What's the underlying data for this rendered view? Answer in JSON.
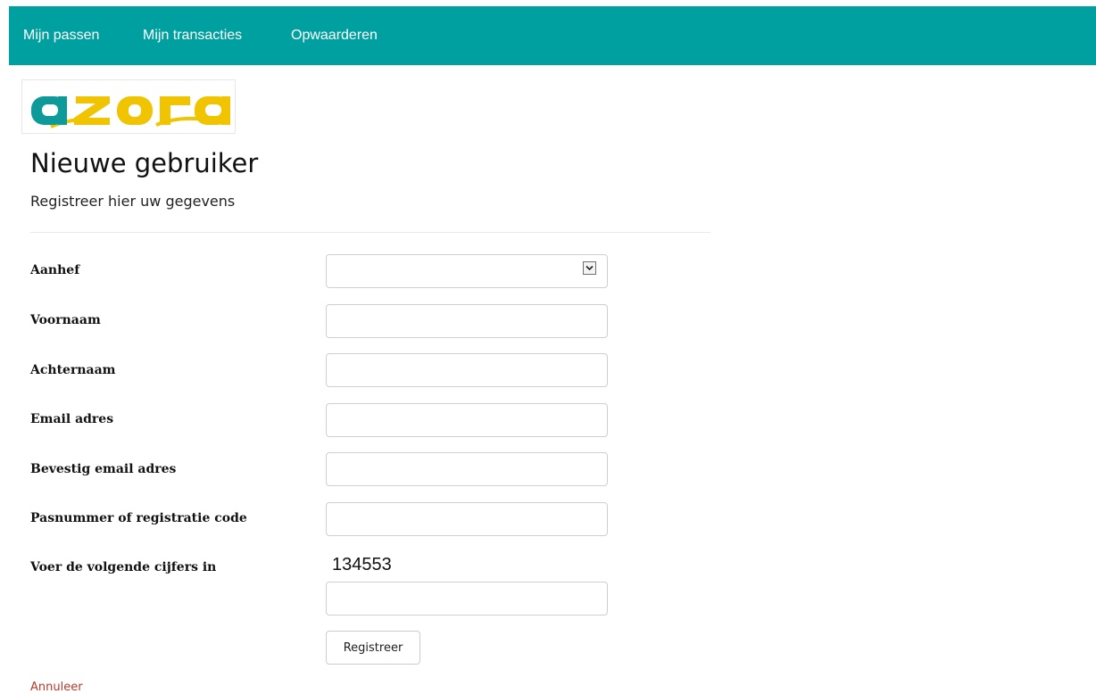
{
  "nav": {
    "items": [
      {
        "label": "Mijn passen"
      },
      {
        "label": "Mijn transacties"
      },
      {
        "label": "Opwaarderen"
      }
    ],
    "background_color": "#00a0a0"
  },
  "logo": {
    "text": "azora",
    "colors": {
      "teal": "#0f9a9a",
      "yellow": "#f0c400"
    }
  },
  "header": {
    "title": "Nieuwe gebruiker",
    "subtitle": "Registreer hier uw gegevens"
  },
  "form": {
    "salutation": {
      "label": "Aanhef",
      "value": ""
    },
    "first_name": {
      "label": "Voornaam",
      "value": ""
    },
    "last_name": {
      "label": "Achternaam",
      "value": ""
    },
    "email": {
      "label": "Email adres",
      "value": ""
    },
    "email_confirm": {
      "label": "Bevestig email adres",
      "value": ""
    },
    "card_number": {
      "label": "Pasnummer of registratie code",
      "value": ""
    },
    "captcha": {
      "label": "Voer de volgende cijfers in",
      "code": "134553",
      "value": ""
    },
    "submit_label": "Registreer"
  },
  "cancel_label": "Annuleer",
  "icons": {
    "select_arrow": "chevron-down-icon"
  }
}
